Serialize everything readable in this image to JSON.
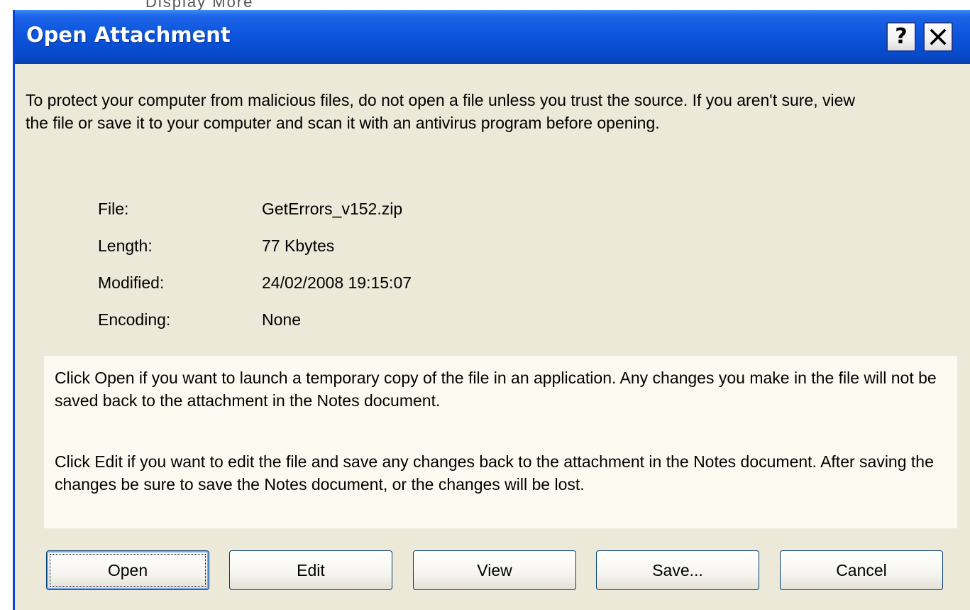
{
  "background": {
    "partial_toolbar_text": "Display  More"
  },
  "dialog": {
    "title": "Open Attachment",
    "help_label": "?",
    "warning": "To protect your computer from malicious files, do not open a file unless you trust the source. If you aren't sure, view the file or save it to your computer and scan it with an antivirus program before opening.",
    "file_info": [
      {
        "label": "File:",
        "value": "GetErrors_v152.zip"
      },
      {
        "label": "Length:",
        "value": "77 Kbytes"
      },
      {
        "label": "Modified:",
        "value": "24/02/2008 19:15:07"
      },
      {
        "label": "Encoding:",
        "value": "None"
      }
    ],
    "hints": {
      "open": "Click Open if you want to launch a temporary copy of the file in an application. Any changes you make in the file will not be saved back to the attachment in the Notes document.",
      "edit": "Click Edit if you want to edit the file and save any changes back to the attachment in the Notes document. After saving the changes be sure to save the Notes document, or the changes will be lost."
    },
    "buttons": {
      "open": "Open",
      "edit": "Edit",
      "view": "View",
      "save": "Save...",
      "cancel": "Cancel"
    }
  },
  "colors": {
    "titlebar": "#0a54dc",
    "dialog_bg": "#ece9d8",
    "hint_panel_bg": "#fcfaf0"
  },
  "icons": {
    "help": "help-icon",
    "close": "close-icon"
  }
}
